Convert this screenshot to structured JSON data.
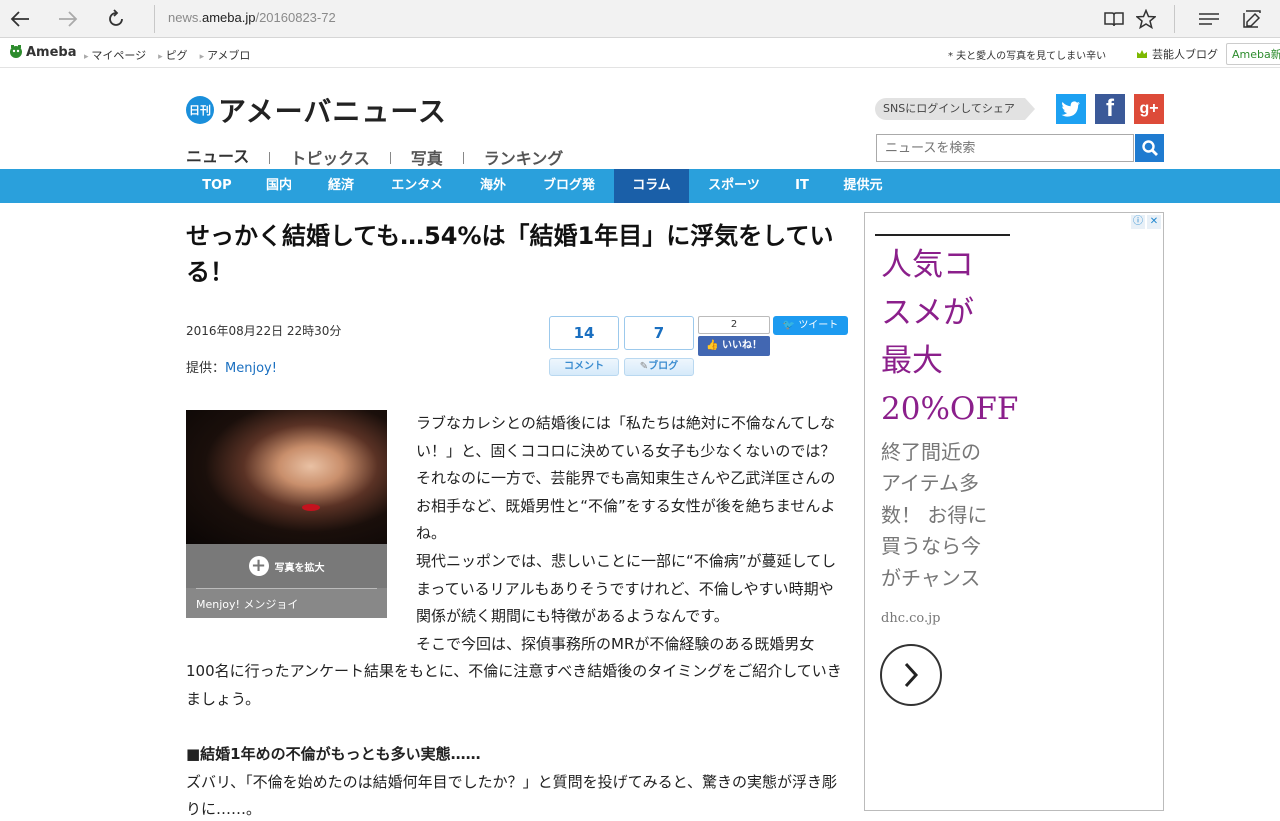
{
  "browser": {
    "url_prefix": "news.",
    "url_domain": "ameba.jp",
    "url_path": "/20160823-72"
  },
  "ameba_bar": {
    "logo": "Ameba",
    "links": [
      "マイページ",
      "ピグ",
      "アメブロ"
    ],
    "headline_link": "* 夫と愛人の写真を見てしまい辛い",
    "celebrity_blog": "芸能人ブログ",
    "new_reg": "Ameba新規"
  },
  "header": {
    "nikkan": "日刊",
    "site_title": "アメーバニュース",
    "subnav": [
      "ニュース",
      "トピックス",
      "写真",
      "ランキング"
    ],
    "share_label": "SNSにログインしてシェア",
    "search_placeholder": "ニュースを検索"
  },
  "categories": [
    "TOP",
    "国内",
    "経済",
    "エンタメ",
    "海外",
    "ブログ発",
    "コラム",
    "スポーツ",
    "IT",
    "提供元"
  ],
  "active_category": "コラム",
  "article": {
    "title": "せっかく結婚しても…54%は「結婚1年目」に浮気をしている！",
    "date": "2016年08月22日 22時30分",
    "provider_label": "提供：",
    "provider_name": "Menjoy!",
    "comment_count": "14",
    "comment_label": "コメント",
    "blog_count": "7",
    "blog_label": "ブログ",
    "like_count": "2",
    "like_label": "いいね！",
    "tweet_label": "ツイート",
    "photo_enlarge": "写真を拡大",
    "photo_credit": "Menjoy! メンジョイ",
    "paragraphs": [
      "ラブなカレシとの結婚後には「私たちは絶対に不倫なんてしない！」と、固くココロに決めている女子も少なくないのでは？",
      "それなのに一方で、芸能界でも高知東生さんや乙武洋匡さんのお相手など、既婚男性と“不倫”をする女性が後を絶ちませんよね。",
      "現代ニッポンでは、悲しいことに一部に“不倫病”が蔓延してしまっているリアルもありそうですけれど、不倫しやすい時期や関係が続く期間にも特徴があるようなんです。",
      "そこで今回は、探偵事務所のMRが不倫経験のある既婚男女100名に行ったアンケート結果をもとに、不倫に注意すべき結婚後のタイミングをご紹介していきましょう。"
    ],
    "subheading": "■結婚1年めの不倫がもっとも多い実態……",
    "paragraph_after": "ズバリ、「不倫を始めたのは結婚何年目でしたか？」と質問を投げてみると、驚きの実態が浮き彫りに……。"
  },
  "ad": {
    "headline_lines": [
      "人気コ",
      "スメが",
      "最大",
      "20%OFF"
    ],
    "sub_lines": [
      "終了間近の",
      "アイテム多",
      "数！ お得に",
      "買うなら今",
      "がチャンス"
    ],
    "domain": "dhc.co.jp",
    "headline_color": "#8b1f8b"
  },
  "colors": {
    "category_bar": "#2aa0dc",
    "category_active": "#1a5fa8",
    "link": "#1a6fc0"
  }
}
